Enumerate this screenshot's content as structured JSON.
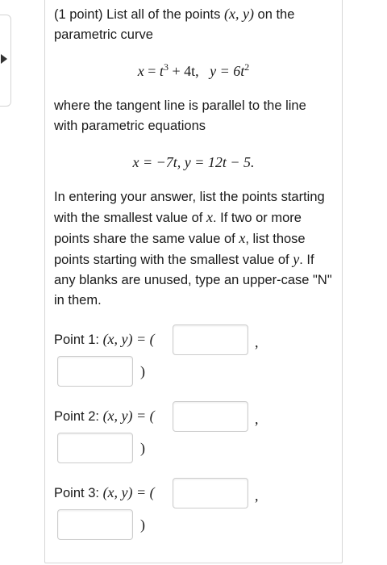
{
  "problem": {
    "intro_prefix": "(1 point) List all of the points",
    "intro_xy": "(x, y)",
    "intro_suffix": "on the parametric curve",
    "curve_eq_x_lhs": "x",
    "curve_eq_x_rhs_a": "t",
    "curve_eq_x_exp": "3",
    "curve_eq_x_rhs_b": "+ 4t,",
    "curve_eq_y": "y = 6t",
    "curve_eq_y_exp": "2",
    "tangent_text": "where the tangent line is parallel to the line with parametric equations",
    "line_eq": "x = −7t,   y = 12t − 5.",
    "instructions_1": "In entering your answer, list the points starting with the smallest value of",
    "instructions_x": "x",
    "instructions_2": ". If two or more points share the same value of",
    "instructions_x2": "x",
    "instructions_3": ", list those points starting with the smallest value of",
    "instructions_y": "y",
    "instructions_4": ". If any blanks are unused, type an upper-case \"N\" in them."
  },
  "points": [
    {
      "label": "Point 1:",
      "xy": "(x, y) = (",
      "x_value": "",
      "y_value": "",
      "comma": ",",
      "close": ")"
    },
    {
      "label": "Point 2:",
      "xy": "(x, y) = (",
      "x_value": "",
      "y_value": "",
      "comma": ",",
      "close": ")"
    },
    {
      "label": "Point 3:",
      "xy": "(x, y) = (",
      "x_value": "",
      "y_value": "",
      "comma": ",",
      "close": ")"
    }
  ]
}
